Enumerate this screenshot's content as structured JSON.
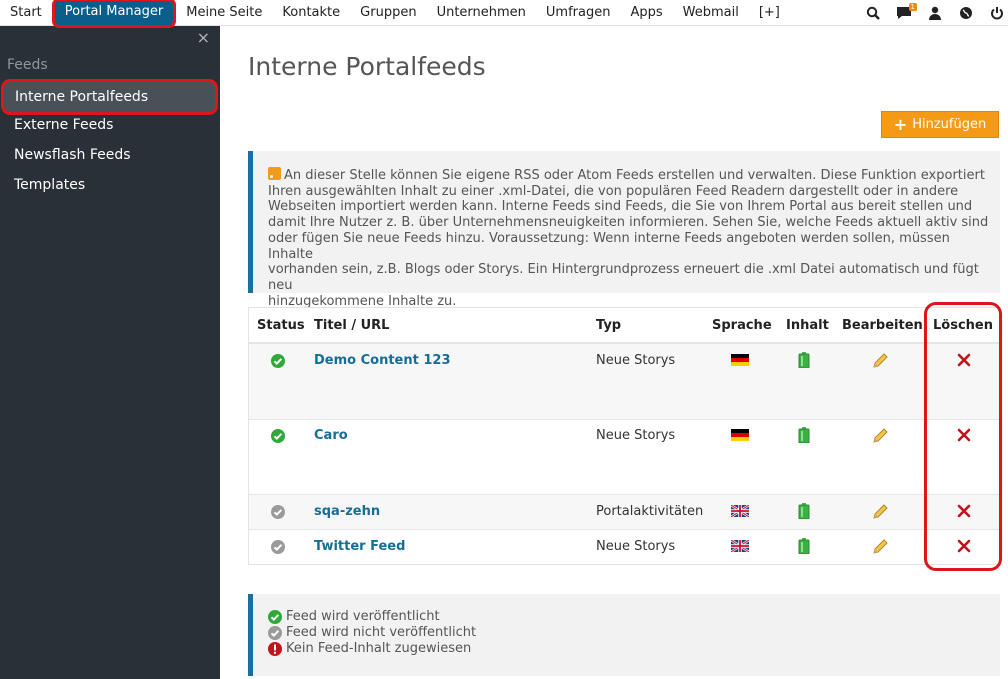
{
  "nav": {
    "items": [
      "Start",
      "Portal Manager",
      "Meine Seite",
      "Kontakte",
      "Gruppen",
      "Unternehmen",
      "Umfragen",
      "Apps",
      "Webmail",
      "[+]"
    ],
    "active": "Portal Manager",
    "icons": [
      "search-icon",
      "chat-icon",
      "user-icon",
      "globe-icon",
      "power-icon"
    ],
    "chat_badge": "1"
  },
  "sidebar": {
    "close": "×",
    "heading": "Feeds",
    "items": [
      "Interne Portalfeeds",
      "Externe Feeds",
      "Newsflash Feeds",
      "Templates"
    ],
    "active": "Interne Portalfeeds"
  },
  "main": {
    "title": "Interne Portalfeeds",
    "add_button": "Hinzufügen",
    "info_lines": [
      "An dieser Stelle können Sie eigene RSS oder Atom Feeds erstellen und verwalten. Diese Funktion exportiert",
      "Ihren ausgewählten Inhalt zu einer .xml-Datei, die von populären Feed Readern dargestellt oder in andere",
      "Webseiten importiert werden kann. Interne Feeds sind Feeds, die Sie von Ihrem Portal aus bereit stellen und",
      "damit Ihre Nutzer z. B. über Unternehmensneuigkeiten informieren. Sehen Sie, welche Feeds aktuell aktiv sind",
      "oder fügen Sie neue Feeds hinzu. Voraussetzung: Wenn interne Feeds angeboten werden sollen, müssen Inhalte",
      "vorhanden sein, z.B. Blogs oder Storys. Ein Hintergrundprozess erneuert die .xml Datei automatisch und fügt neu",
      "hinzugekommene Inhalte zu."
    ]
  },
  "table": {
    "headers": [
      "Status",
      "Titel / URL",
      "Typ",
      "Sprache",
      "Inhalt",
      "Bearbeiten",
      "Löschen"
    ],
    "rows": [
      {
        "status": "published",
        "title": "Demo Content 123",
        "type": "Neue Storys",
        "language": "de"
      },
      {
        "status": "published",
        "title": "Caro",
        "type": "Neue Storys",
        "language": "de"
      },
      {
        "status": "unpublished",
        "title": "sqa-zehn",
        "type": "Portalaktivitäten",
        "language": "en"
      },
      {
        "status": "unpublished",
        "title": "Twitter Feed",
        "type": "Neue Storys",
        "language": "en"
      }
    ]
  },
  "legend": {
    "published": "Feed wird veröffentlicht",
    "unpublished": "Feed wird nicht veröffentlicht",
    "no_content": "Kein Feed-Inhalt zugewiesen"
  },
  "colors": {
    "sidebar_bg": "#2a3037",
    "accent_blue": "#0a5f8a",
    "link_blue": "#146e96",
    "add_button": "#f59a16",
    "highlight_red": "#e0141b",
    "status_green": "#2faa3a",
    "status_gray": "#9a9a9a",
    "error_red": "#c0131a"
  }
}
